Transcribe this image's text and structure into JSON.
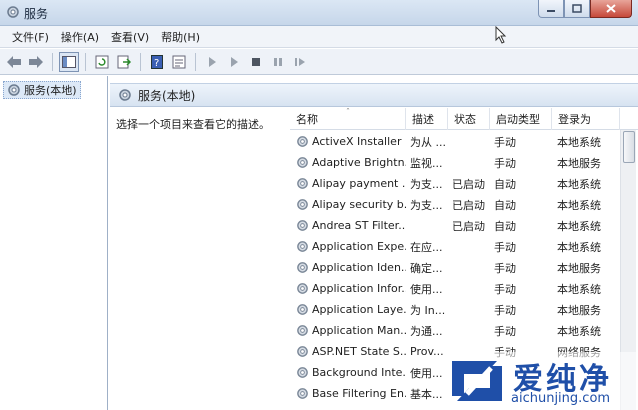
{
  "window": {
    "title": "服务"
  },
  "menu": [
    {
      "label": "文件(F)"
    },
    {
      "label": "操作(A)"
    },
    {
      "label": "查看(V)"
    },
    {
      "label": "帮助(H)"
    }
  ],
  "toolbar": {
    "icons": [
      "back-icon",
      "forward-icon",
      "show-hide-console-tree-icon",
      "refresh-icon",
      "export-list-icon",
      "help-icon",
      "properties-icon",
      "start-service-icon",
      "start-service-alt-icon",
      "stop-service-icon",
      "pause-service-icon",
      "resume-service-icon"
    ]
  },
  "tree": {
    "root_label": "服务(本地)"
  },
  "panel": {
    "header_title": "服务(本地)",
    "description_prompt": "选择一个项目来查看它的描述。"
  },
  "table": {
    "columns": [
      "名称",
      "描述",
      "状态",
      "启动类型",
      "登录为"
    ],
    "sorted_column": "名称",
    "rows": [
      {
        "name": "ActiveX Installer ...",
        "description": "为从 ...",
        "status": "",
        "startup": "手动",
        "logon": "本地系统"
      },
      {
        "name": "Adaptive Brightn...",
        "description": "监视...",
        "status": "",
        "startup": "手动",
        "logon": "本地服务"
      },
      {
        "name": "Alipay payment ...",
        "description": "为支...",
        "status": "已启动",
        "startup": "自动",
        "logon": "本地系统"
      },
      {
        "name": "Alipay security b...",
        "description": "为支...",
        "status": "已启动",
        "startup": "自动",
        "logon": "本地系统"
      },
      {
        "name": "Andrea ST Filter...",
        "description": "",
        "status": "已启动",
        "startup": "自动",
        "logon": "本地系统"
      },
      {
        "name": "Application Expe...",
        "description": "在应...",
        "status": "",
        "startup": "手动",
        "logon": "本地系统"
      },
      {
        "name": "Application Iden...",
        "description": "确定...",
        "status": "",
        "startup": "手动",
        "logon": "本地服务"
      },
      {
        "name": "Application Infor...",
        "description": "使用...",
        "status": "",
        "startup": "手动",
        "logon": "本地系统"
      },
      {
        "name": "Application Laye...",
        "description": "为 In...",
        "status": "",
        "startup": "手动",
        "logon": "本地服务"
      },
      {
        "name": "Application Man...",
        "description": "为通...",
        "status": "",
        "startup": "手动",
        "logon": "本地系统"
      },
      {
        "name": "ASP.NET State S...",
        "description": "Prov...",
        "status": "",
        "startup": "手动",
        "logon": "网络服务"
      },
      {
        "name": "Background Inte...",
        "description": "使用...",
        "status": "",
        "startup": "",
        "logon": ""
      },
      {
        "name": "Base Filtering En...",
        "description": "基本...",
        "status": "",
        "startup": "",
        "logon": ""
      }
    ]
  },
  "watermark": {
    "brand_cn": "爱纯净",
    "brand_url": "aichunjing.com"
  },
  "colors": {
    "accent": "#1f4fa8",
    "title_bar": "#c6d6ea",
    "selection": "#dde9f7"
  }
}
